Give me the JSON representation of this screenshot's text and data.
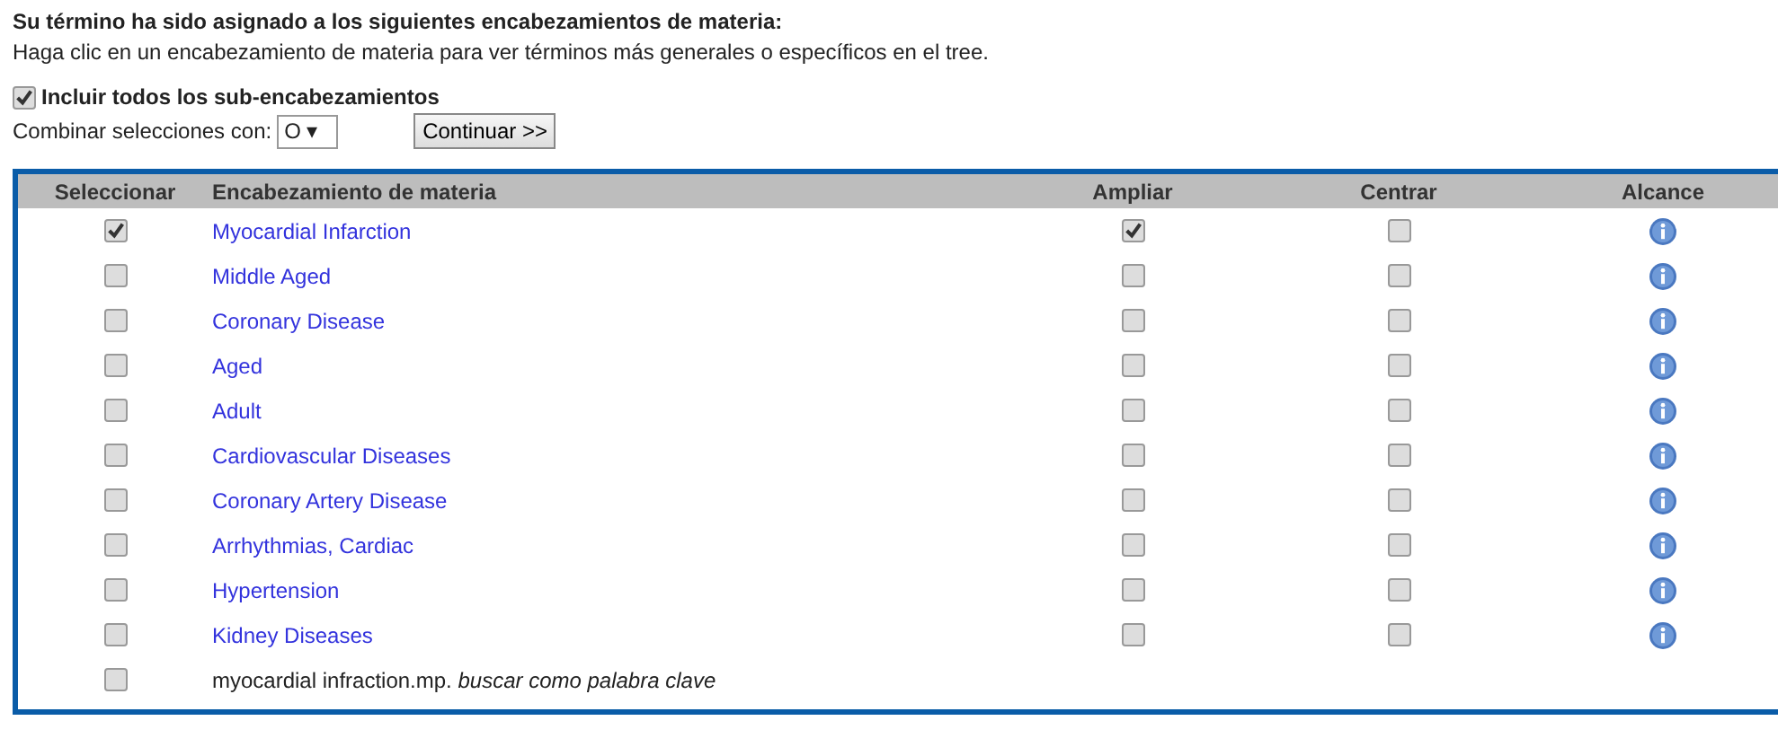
{
  "heading": "Su término ha sido asignado a los siguientes encabezamientos de materia:",
  "instructions": "Haga clic en un encabezamiento de materia para ver términos más generales o específicos en el tree.",
  "include_sub": {
    "label": "Incluir todos los sub-encabezamientos",
    "checked": true
  },
  "combine": {
    "label": "Combinar selecciones con:",
    "value": "O ▾"
  },
  "continue_button": "Continuar >>",
  "table": {
    "columns": [
      "Seleccionar",
      "Encabezamiento de materia",
      "Ampliar",
      "Centrar",
      "Alcance"
    ],
    "rows": [
      {
        "kind": "heading",
        "label": "Myocardial Infarction",
        "select": true,
        "explode": true,
        "focus": false
      },
      {
        "kind": "heading",
        "label": "Middle Aged",
        "select": false,
        "explode": false,
        "focus": false
      },
      {
        "kind": "heading",
        "label": "Coronary Disease",
        "select": false,
        "explode": false,
        "focus": false
      },
      {
        "kind": "heading",
        "label": "Aged",
        "select": false,
        "explode": false,
        "focus": false
      },
      {
        "kind": "heading",
        "label": "Adult",
        "select": false,
        "explode": false,
        "focus": false
      },
      {
        "kind": "heading",
        "label": "Cardiovascular Diseases",
        "select": false,
        "explode": false,
        "focus": false
      },
      {
        "kind": "heading",
        "label": "Coronary Artery Disease",
        "select": false,
        "explode": false,
        "focus": false
      },
      {
        "kind": "heading",
        "label": "Arrhythmias, Cardiac",
        "select": false,
        "explode": false,
        "focus": false
      },
      {
        "kind": "heading",
        "label": "Hypertension",
        "select": false,
        "explode": false,
        "focus": false
      },
      {
        "kind": "heading",
        "label": "Kidney Diseases",
        "select": false,
        "explode": false,
        "focus": false
      },
      {
        "kind": "keyword",
        "label": "myocardial infraction.mp. *buscar como palabra clave*",
        "select": false
      }
    ]
  }
}
